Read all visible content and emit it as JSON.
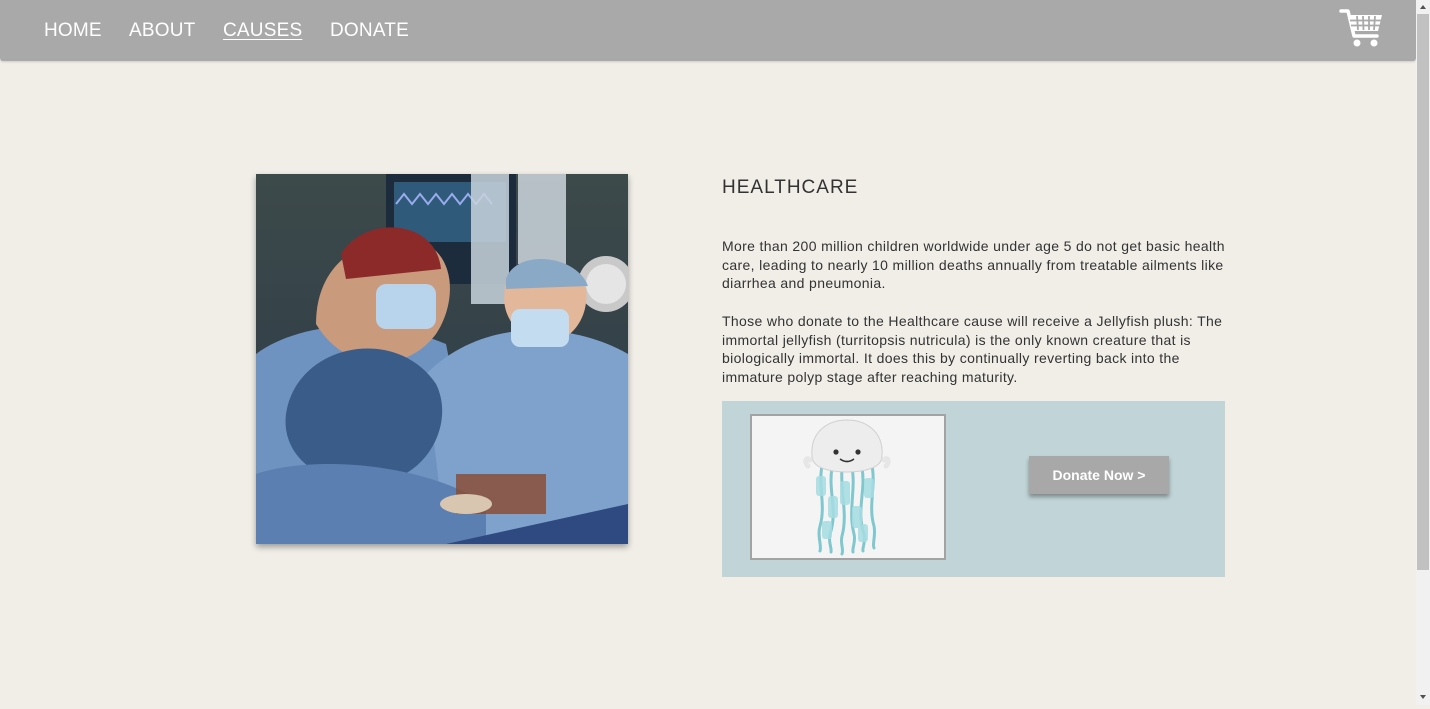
{
  "nav": {
    "links": [
      {
        "label": "HOME"
      },
      {
        "label": "ABOUT"
      },
      {
        "label": "CAUSES",
        "active": true
      },
      {
        "label": "DONATE"
      }
    ],
    "cart_icon": "shopping-cart-icon"
  },
  "cause": {
    "title": "HEALTHCARE",
    "paragraph1": "More than 200 million children worldwide under age 5 do not get basic health care, leading to nearly 10 million deaths annually from treatable ailments like diarrhea and pneumonia.",
    "paragraph2": "Those who donate to the Healthcare cause will receive a Jellyfish plush: The immortal jellyfish (turritopsis nutricula) is the only known creature that is biologically immortal. It does this by continually reverting back into the immature polyp stage after reaching maturity."
  },
  "reward": {
    "button_label": "Donate Now >"
  },
  "colors": {
    "nav_bg": "#a9a9a9",
    "page_bg": "#f1eee8",
    "reward_bg": "#c1d4d7",
    "button_bg": "#a8a8a8"
  }
}
